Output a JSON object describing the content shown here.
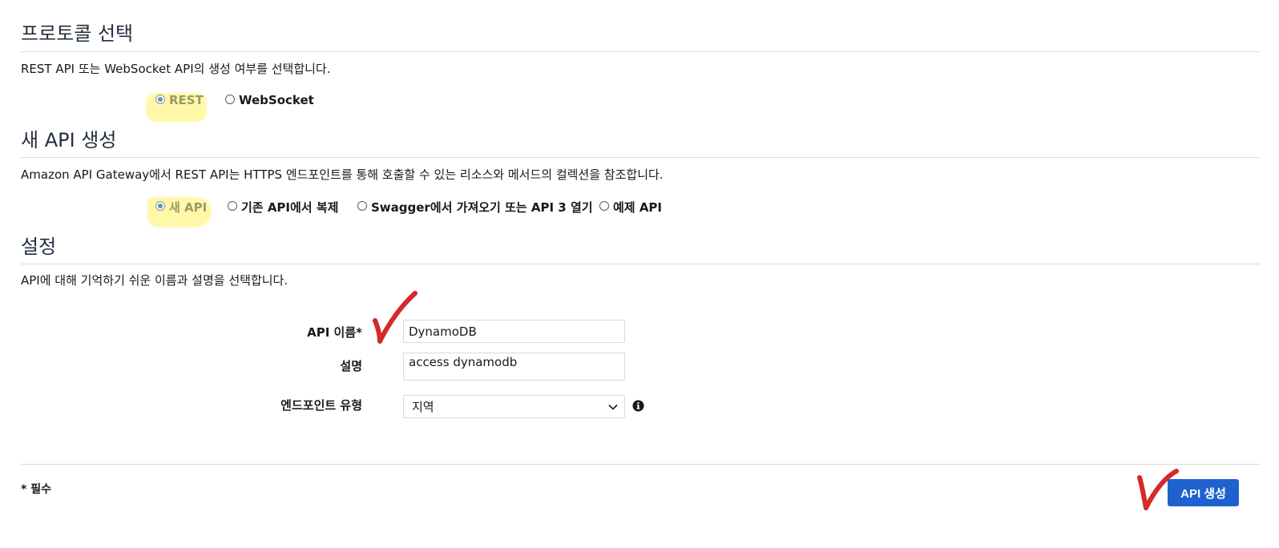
{
  "protocol": {
    "title": "프로토콜 선택",
    "description": "REST API 또는 WebSocket API의 생성 여부를 선택합니다.",
    "options": [
      {
        "label": "REST",
        "selected": true
      },
      {
        "label": "WebSocket",
        "selected": false
      }
    ]
  },
  "new_api": {
    "title": "새 API 생성",
    "description": "Amazon API Gateway에서 REST API는 HTTPS 엔드포인트를 통해 호출할 수 있는 리소스와 메서드의 컬렉션을 참조합니다.",
    "options": [
      {
        "label": "새 API",
        "selected": true
      },
      {
        "label": "기존 API에서 복제",
        "selected": false
      },
      {
        "label": "Swagger에서 가져오기 또는 API 3 열기",
        "selected": false
      },
      {
        "label": "예제 API",
        "selected": false
      }
    ]
  },
  "settings": {
    "title": "설정",
    "description": "API에 대해 기억하기 쉬운 이름과 설명을 선택합니다.",
    "api_name_label": "API 이름*",
    "api_name_value": "DynamoDB",
    "description_label": "설명",
    "description_value": "access dynamodb",
    "endpoint_label": "엔드포인트 유형",
    "endpoint_value": "지역"
  },
  "footer": {
    "required_note": "* 필수",
    "create_button": "API 생성"
  },
  "colors": {
    "primary_button": "#1f62cf",
    "highlight": "#fff68c",
    "annotation_check": "#d42a2a"
  },
  "icons": {
    "info": "info-icon",
    "dropdown": "chevron-down-icon",
    "annotation": "checkmark-annotation"
  }
}
